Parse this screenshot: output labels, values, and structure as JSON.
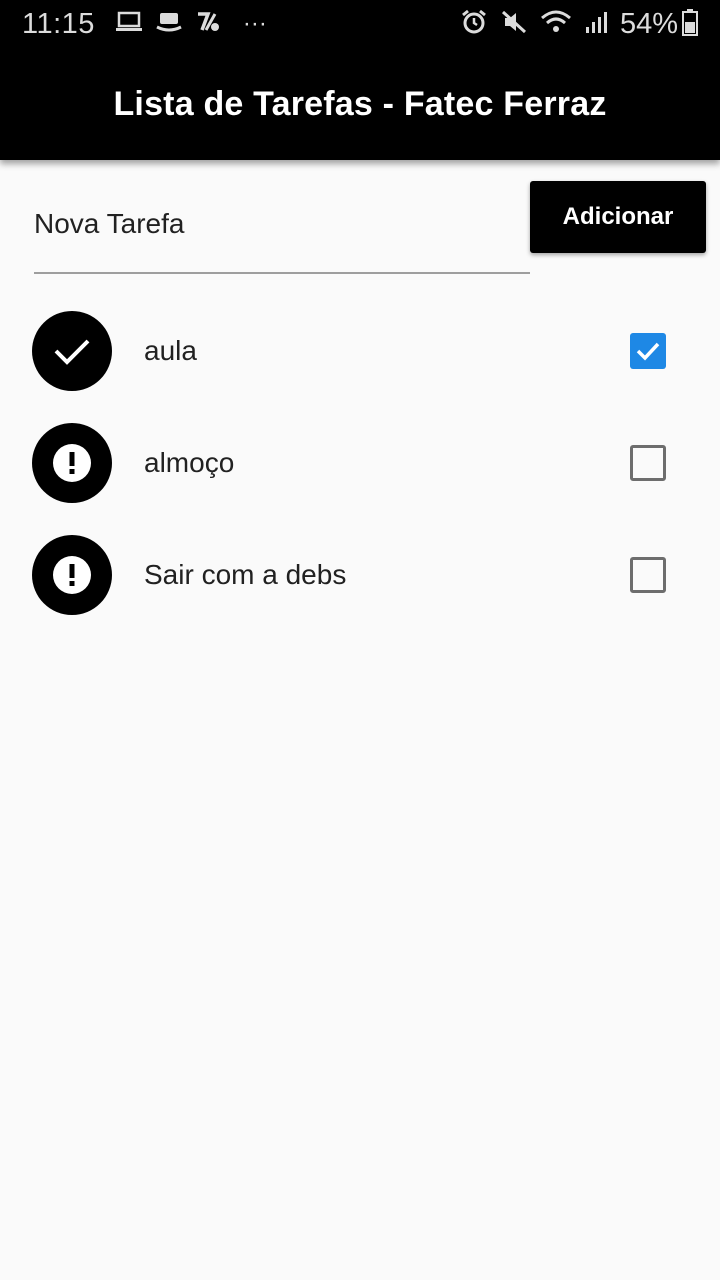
{
  "status_bar": {
    "time": "11:15",
    "more": "···",
    "battery": "54%",
    "icons": [
      "laptop-icon",
      "hat-icon",
      "percent-app-icon",
      "alarm-icon",
      "mute-icon",
      "wifi-icon",
      "signal-icon",
      "battery-icon"
    ]
  },
  "app_bar": {
    "title": "Lista de Tarefas - Fatec Ferraz"
  },
  "new_task": {
    "placeholder": "Nova Tarefa",
    "value": "",
    "button_label": "Adicionar"
  },
  "tasks": [
    {
      "label": "aula",
      "done": true,
      "icon": "check-icon"
    },
    {
      "label": "almoço",
      "done": false,
      "icon": "alert-icon"
    },
    {
      "label": "Sair com a debs",
      "done": false,
      "icon": "alert-icon"
    }
  ],
  "colors": {
    "app_bar": "#000000",
    "background": "#fafafa",
    "checkbox_checked": "#1e88e5",
    "checkbox_unchecked_border": "#6d6d6d"
  }
}
